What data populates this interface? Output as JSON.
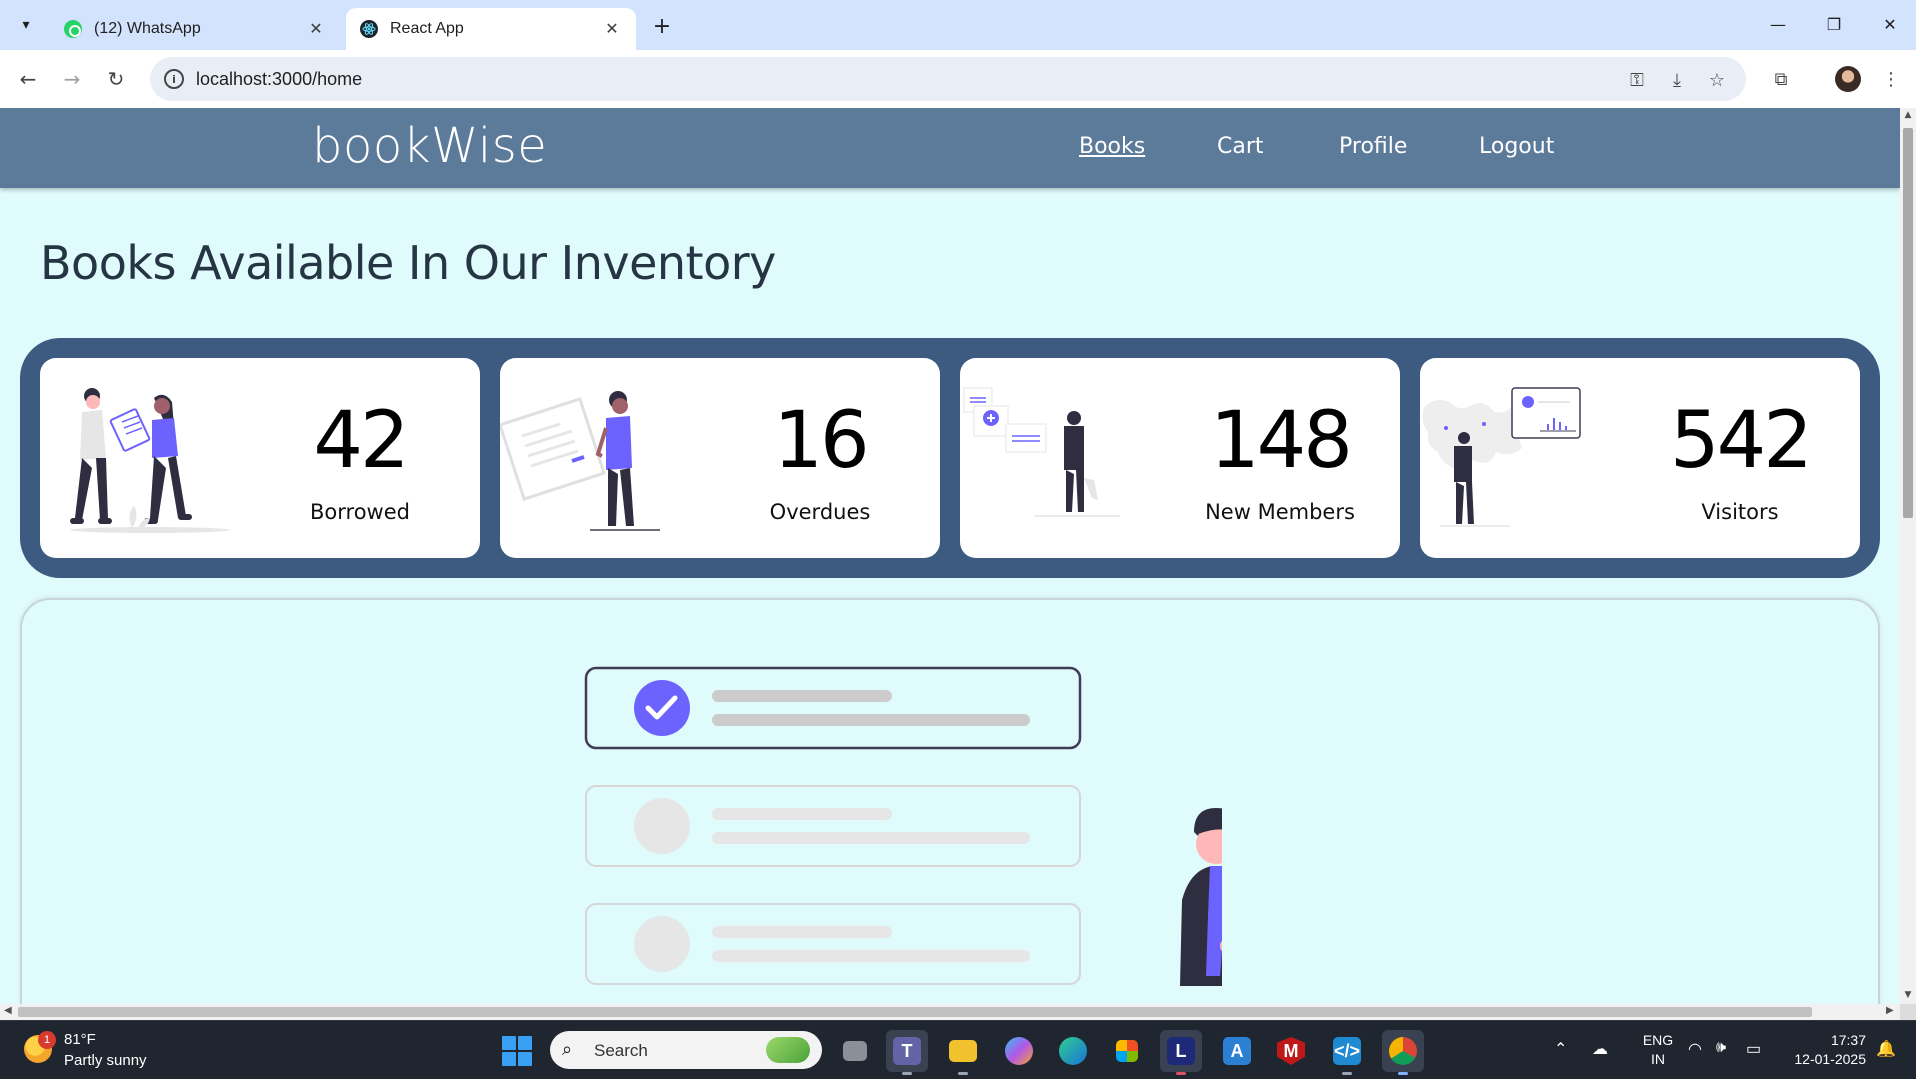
{
  "browser": {
    "tabs": [
      {
        "title": "(12) WhatsApp",
        "icon": "whatsapp-icon",
        "active": false
      },
      {
        "title": "React App",
        "icon": "react-icon",
        "active": true
      }
    ],
    "address": "localhost:3000/home"
  },
  "app": {
    "brand": "bookWise",
    "nav": [
      "Books",
      "Cart",
      "Profile",
      "Logout"
    ],
    "current_nav": "Books",
    "heading": "Books Available In Our Inventory",
    "colors": {
      "header": "#5c7a99",
      "band": "#3d5a80",
      "page_bg": "#e0fbfc",
      "accent": "#6c63ff"
    }
  },
  "stats": [
    {
      "value": "42",
      "label": "Borrowed",
      "illustration": "handover-illustration"
    },
    {
      "value": "16",
      "label": "Overdues",
      "illustration": "document-illustration"
    },
    {
      "value": "148",
      "label": "New Members",
      "illustration": "add-members-illustration"
    },
    {
      "value": "542",
      "label": "Visitors",
      "illustration": "world-map-illustration"
    }
  ],
  "checklist_illustration": {
    "checked_items": 1,
    "total_items": 3
  },
  "taskbar": {
    "weather_temp": "81°F",
    "weather_desc": "Partly sunny",
    "weather_badge": "1",
    "search_placeholder": "Search",
    "lang_top": "ENG",
    "lang_bottom": "IN",
    "time": "17:37",
    "date": "12-01-2025"
  }
}
